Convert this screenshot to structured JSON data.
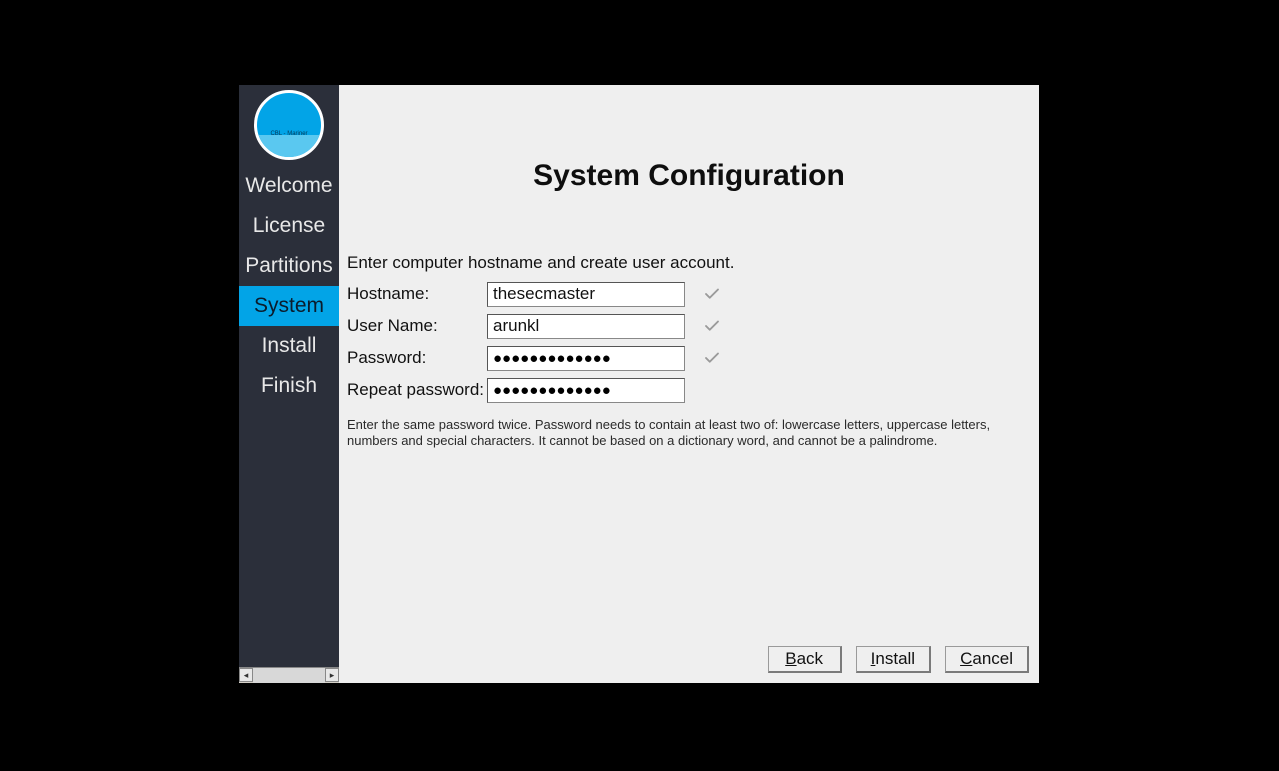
{
  "logo_text": "CBL - Mariner",
  "sidebar": {
    "items": [
      {
        "label": "Welcome",
        "active": false
      },
      {
        "label": "License",
        "active": false
      },
      {
        "label": "Partitions",
        "active": false
      },
      {
        "label": "System",
        "active": true
      },
      {
        "label": "Install",
        "active": false
      },
      {
        "label": "Finish",
        "active": false
      }
    ]
  },
  "main": {
    "title": "System Configuration",
    "instruction": "Enter computer hostname and create user account.",
    "labels": {
      "hostname": "Hostname:",
      "username": "User Name:",
      "password": "Password:",
      "repeat": "Repeat password:"
    },
    "values": {
      "hostname": "thesecmaster",
      "username": "arunkl",
      "password_mask": "●●●●●●●●●●●●●",
      "repeat_mask": "●●●●●●●●●●●●●"
    },
    "hint": "Enter the same password twice. Password needs to contain at least two of: lowercase letters, uppercase letters, numbers and special characters. It cannot be based on a dictionary word, and cannot be a palindrome."
  },
  "buttons": {
    "back": "Back",
    "install": "Install",
    "cancel": "Cancel"
  }
}
